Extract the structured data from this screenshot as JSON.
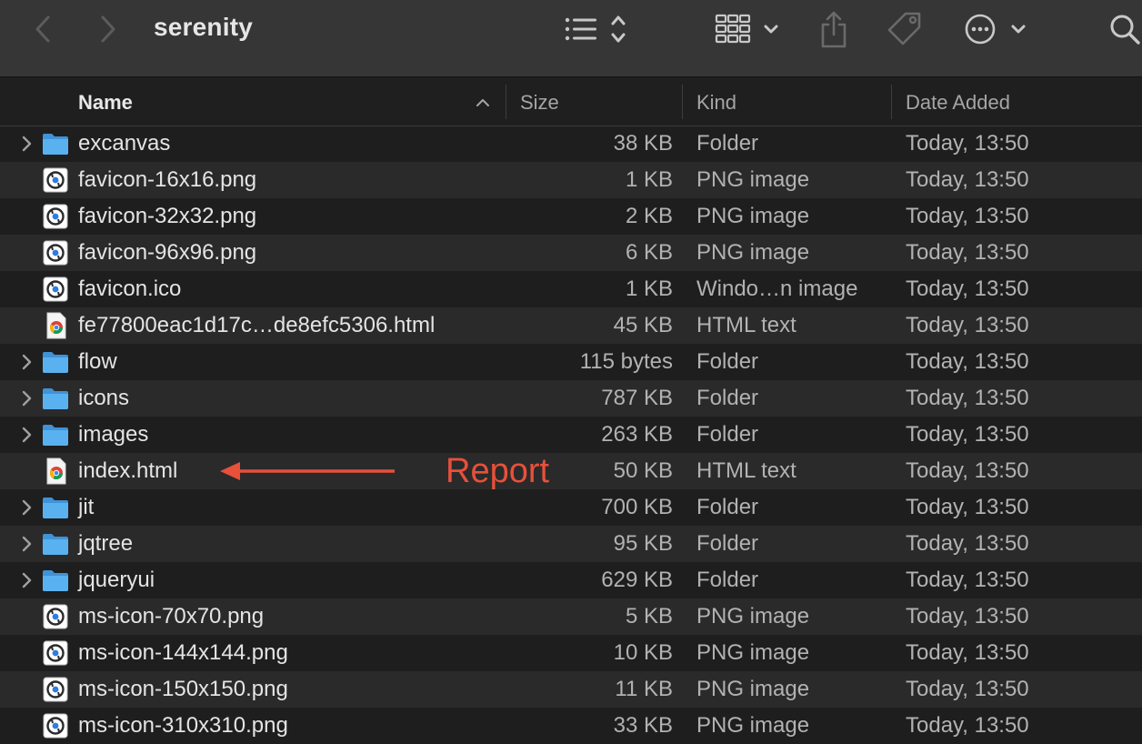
{
  "window": {
    "title": "serenity"
  },
  "toolbar": {
    "back_icon": "chevron-left-icon",
    "forward_icon": "chevron-right-icon",
    "list_view_icon": "list-view-icon",
    "grid_view_icon": "icon-grid-view-icon",
    "share_icon": "share-icon",
    "tag_icon": "tag-icon",
    "more_icon": "ellipsis-circle-icon",
    "search_icon": "search-icon"
  },
  "columns": {
    "name": "Name",
    "size": "Size",
    "kind": "Kind",
    "date": "Date Added"
  },
  "colors": {
    "folder": "#5ab1f0",
    "annotation": "#e8503a"
  },
  "files": [
    {
      "name": "excanvas",
      "size": "38 KB",
      "kind": "Folder",
      "date": "Today, 13:50",
      "type": "folder"
    },
    {
      "name": "favicon-16x16.png",
      "size": "1 KB",
      "kind": "PNG image",
      "date": "Today, 13:50",
      "type": "png"
    },
    {
      "name": "favicon-32x32.png",
      "size": "2 KB",
      "kind": "PNG image",
      "date": "Today, 13:50",
      "type": "png"
    },
    {
      "name": "favicon-96x96.png",
      "size": "6 KB",
      "kind": "PNG image",
      "date": "Today, 13:50",
      "type": "png"
    },
    {
      "name": "favicon.ico",
      "size": "1 KB",
      "kind": "Windo…n image",
      "date": "Today, 13:50",
      "type": "png"
    },
    {
      "name": "fe77800eac1d17c…de8efc5306.html",
      "size": "45 KB",
      "kind": "HTML text",
      "date": "Today, 13:50",
      "type": "html"
    },
    {
      "name": "flow",
      "size": "115 bytes",
      "kind": "Folder",
      "date": "Today, 13:50",
      "type": "folder"
    },
    {
      "name": "icons",
      "size": "787 KB",
      "kind": "Folder",
      "date": "Today, 13:50",
      "type": "folder"
    },
    {
      "name": "images",
      "size": "263 KB",
      "kind": "Folder",
      "date": "Today, 13:50",
      "type": "folder"
    },
    {
      "name": "index.html",
      "size": "50 KB",
      "kind": "HTML text",
      "date": "Today, 13:50",
      "type": "html"
    },
    {
      "name": "jit",
      "size": "700 KB",
      "kind": "Folder",
      "date": "Today, 13:50",
      "type": "folder"
    },
    {
      "name": "jqtree",
      "size": "95 KB",
      "kind": "Folder",
      "date": "Today, 13:50",
      "type": "folder"
    },
    {
      "name": "jqueryui",
      "size": "629 KB",
      "kind": "Folder",
      "date": "Today, 13:50",
      "type": "folder"
    },
    {
      "name": "ms-icon-70x70.png",
      "size": "5 KB",
      "kind": "PNG image",
      "date": "Today, 13:50",
      "type": "png"
    },
    {
      "name": "ms-icon-144x144.png",
      "size": "10 KB",
      "kind": "PNG image",
      "date": "Today, 13:50",
      "type": "png"
    },
    {
      "name": "ms-icon-150x150.png",
      "size": "11 KB",
      "kind": "PNG image",
      "date": "Today, 13:50",
      "type": "png"
    },
    {
      "name": "ms-icon-310x310.png",
      "size": "33 KB",
      "kind": "PNG image",
      "date": "Today, 13:50",
      "type": "png"
    }
  ],
  "annotation": {
    "text": "Report",
    "icon": "arrow-left-icon"
  }
}
